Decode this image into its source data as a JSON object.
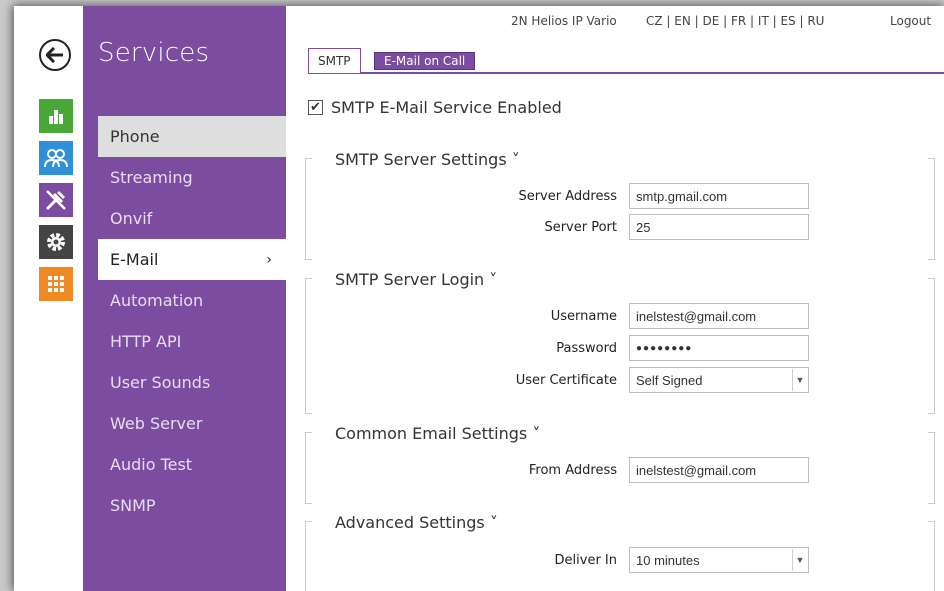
{
  "header": {
    "device_name": "2N Helios IP Vario",
    "languages": "CZ | EN | DE | FR | IT | ES | RU",
    "logout_label": "Logout"
  },
  "sidebar": {
    "title": "Services",
    "items": [
      {
        "label": "Phone"
      },
      {
        "label": "Streaming"
      },
      {
        "label": "Onvif"
      },
      {
        "label": "E-Mail"
      },
      {
        "label": "Automation"
      },
      {
        "label": "HTTP API"
      },
      {
        "label": "User Sounds"
      },
      {
        "label": "Web Server"
      },
      {
        "label": "Audio Test"
      },
      {
        "label": "SNMP"
      }
    ],
    "active_chevron": "›"
  },
  "tabs": [
    {
      "label": "SMTP"
    },
    {
      "label": "E-Mail on Call"
    }
  ],
  "smtp_enabled": {
    "label": "SMTP E-Mail Service Enabled",
    "checked_mark": "✔"
  },
  "sections": {
    "server_settings": {
      "title": "SMTP Server Settings ˅",
      "server_address_label": "Server Address",
      "server_address_value": "smtp.gmail.com",
      "server_port_label": "Server Port",
      "server_port_value": "25"
    },
    "server_login": {
      "title": "SMTP Server Login ˅",
      "username_label": "Username",
      "username_value": "inelstest@gmail.com",
      "password_label": "Password",
      "password_value": "●●●●●●●●",
      "certificate_label": "User Certificate",
      "certificate_value": "Self Signed"
    },
    "common": {
      "title": "Common Email Settings ˅",
      "from_label": "From Address",
      "from_value": "inelstest@gmail.com"
    },
    "advanced": {
      "title": "Advanced Settings ˅",
      "deliver_label": "Deliver In",
      "deliver_value": "10 minutes"
    }
  },
  "colors": {
    "accent": "#7b4c9f",
    "icon_green": "#4aa838",
    "icon_blue": "#2f8fd8",
    "icon_purple": "#7b4c9f",
    "icon_dark": "#444444",
    "icon_orange": "#f08a24"
  }
}
